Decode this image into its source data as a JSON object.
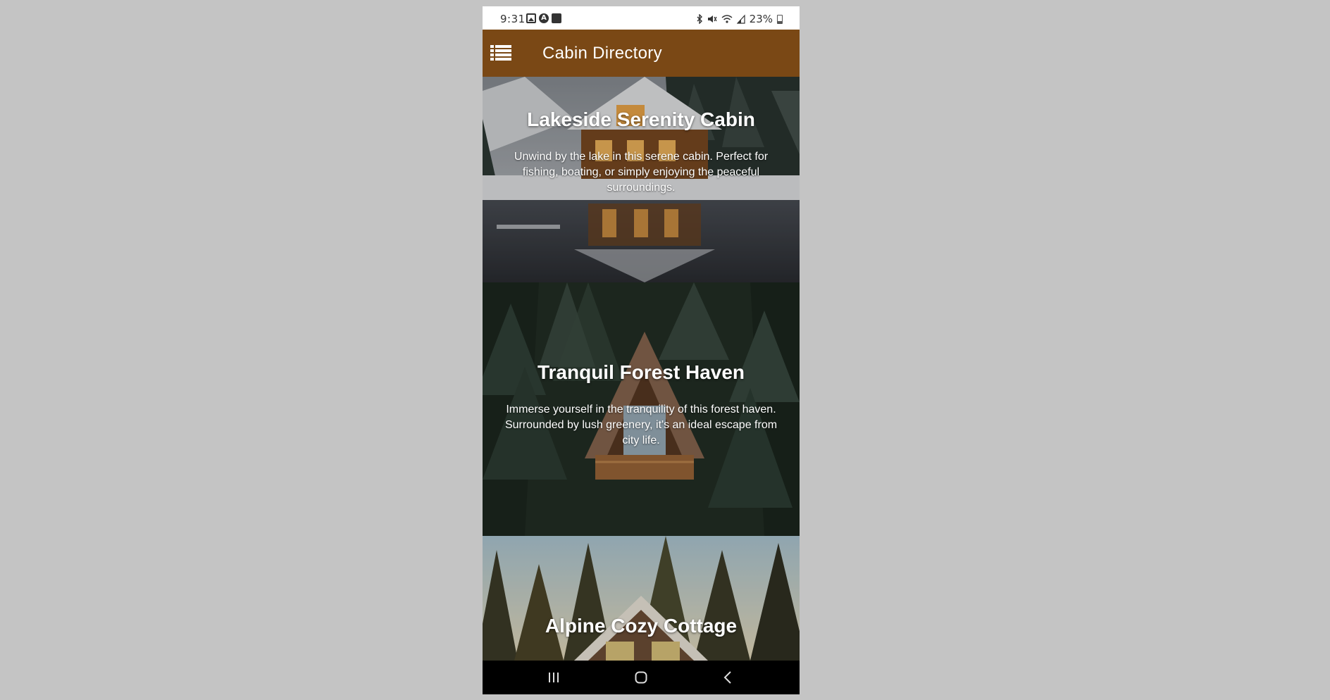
{
  "status_bar": {
    "time": "9:31",
    "battery": "23%",
    "left_icons": [
      "image-icon",
      "a-circle-icon",
      "cast-icon"
    ],
    "right_icons": [
      "bluetooth-icon",
      "mute-icon",
      "wifi-icon",
      "signal-icon",
      "battery-icon"
    ]
  },
  "app_bar": {
    "title": "Cabin Directory",
    "background": "#7a4815",
    "menu_icon": "list-icon"
  },
  "cabins": [
    {
      "title": "Lakeside Serenity Cabin",
      "description": "Unwind by the lake in this serene cabin. Perfect for fishing, boating, or simply enjoying the peaceful surroundings."
    },
    {
      "title": "Tranquil Forest Haven",
      "description": "Immerse yourself in the tranquility of this forest haven. Surrounded by lush greenery, it's an ideal escape from city life."
    },
    {
      "title": "Alpine Cozy Cottage",
      "description": ""
    }
  ],
  "nav_bar": {
    "icons": [
      "recents-icon",
      "home-icon",
      "back-icon"
    ]
  }
}
